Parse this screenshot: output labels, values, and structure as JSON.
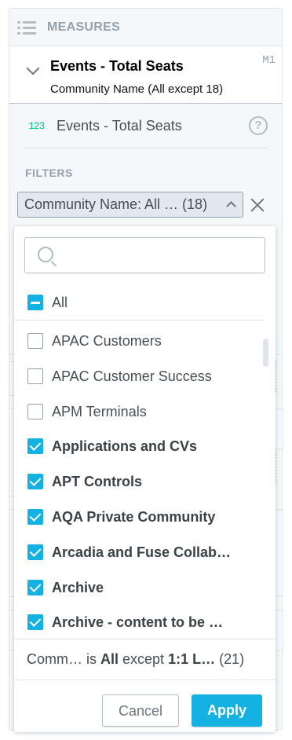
{
  "panel": {
    "title": "MEASURES"
  },
  "measure": {
    "title": "Events - Total Seats",
    "subtitle": "Community Name (All except 18)",
    "tag": "M1"
  },
  "metric": {
    "icon_text": "123",
    "label": "Events - Total Seats",
    "help_icon": "question-circle-icon"
  },
  "filters": {
    "label": "FILTERS",
    "pill": "Community Name: All … (18)"
  },
  "dropdown": {
    "search": {
      "placeholder": ""
    },
    "all_label": "All",
    "items": [
      {
        "label": "APAC Customers",
        "checked": false
      },
      {
        "label": "APAC Customer Success",
        "checked": false
      },
      {
        "label": "APM Terminals",
        "checked": false
      },
      {
        "label": "Applications and CVs",
        "checked": true
      },
      {
        "label": "APT Controls",
        "checked": true
      },
      {
        "label": "AQA Private Community",
        "checked": true
      },
      {
        "label": "Arcadia and Fuse Collab…",
        "checked": true
      },
      {
        "label": "Archive",
        "checked": true
      },
      {
        "label": "Archive - content to be …",
        "checked": true
      }
    ],
    "summary": {
      "prefix": "Comm…  is ",
      "all": "All",
      "except": " except ",
      "value": "1:1 L…",
      "count": " (21)"
    },
    "cancel_label": "Cancel",
    "apply_label": "Apply"
  },
  "colors": {
    "accent": "#14b2e2",
    "metric_icon": "#00c18d"
  }
}
